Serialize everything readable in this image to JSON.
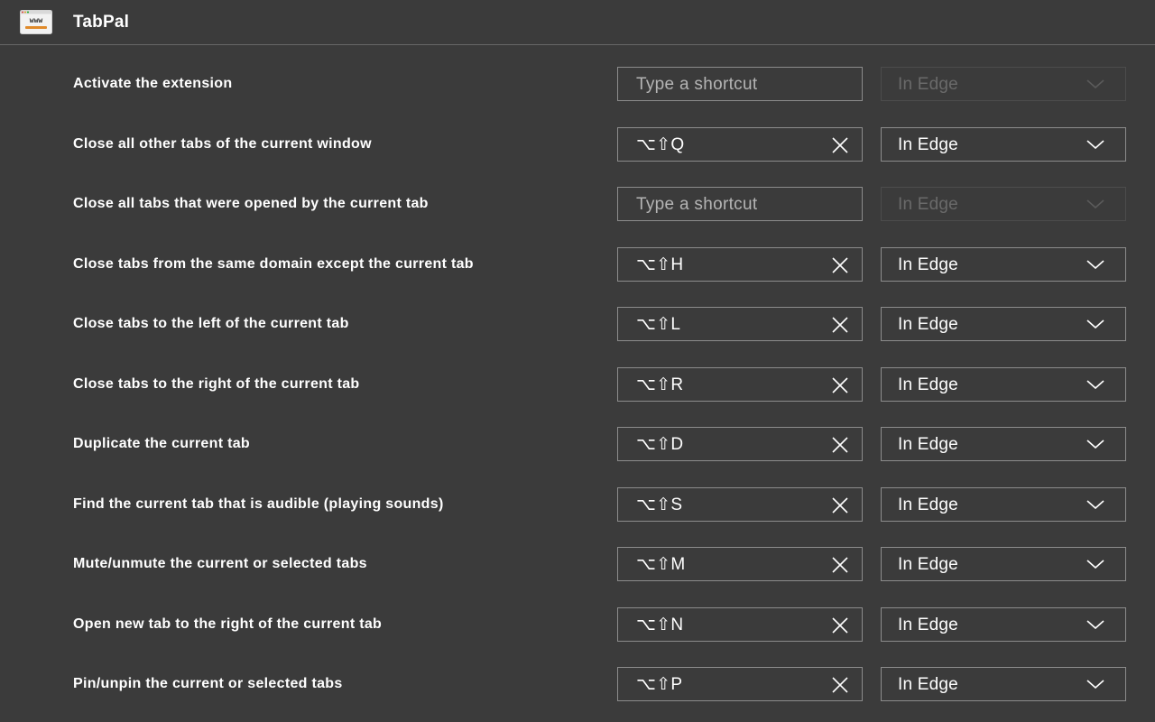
{
  "header": {
    "title": "TabPal",
    "icon_text": "www"
  },
  "rows": [
    {
      "label": "Activate the extension",
      "shortcut": "",
      "placeholder": "Type a shortcut",
      "scope": "In Edge",
      "disabled": true
    },
    {
      "label": "Close all other tabs of the current window",
      "shortcut": "⌥⇧Q",
      "placeholder": "Type a shortcut",
      "scope": "In Edge",
      "disabled": false
    },
    {
      "label": "Close all tabs that were opened by the current tab",
      "shortcut": "",
      "placeholder": "Type a shortcut",
      "scope": "In Edge",
      "disabled": true
    },
    {
      "label": "Close tabs from the same domain except the current tab",
      "shortcut": "⌥⇧H",
      "placeholder": "Type a shortcut",
      "scope": "In Edge",
      "disabled": false
    },
    {
      "label": "Close tabs to the left of the current tab",
      "shortcut": "⌥⇧L",
      "placeholder": "Type a shortcut",
      "scope": "In Edge",
      "disabled": false
    },
    {
      "label": "Close tabs to the right of the current tab",
      "shortcut": "⌥⇧R",
      "placeholder": "Type a shortcut",
      "scope": "In Edge",
      "disabled": false
    },
    {
      "label": "Duplicate the current tab",
      "shortcut": "⌥⇧D",
      "placeholder": "Type a shortcut",
      "scope": "In Edge",
      "disabled": false
    },
    {
      "label": "Find the current tab that is audible (playing sounds)",
      "shortcut": "⌥⇧S",
      "placeholder": "Type a shortcut",
      "scope": "In Edge",
      "disabled": false
    },
    {
      "label": "Mute/unmute the current or selected tabs",
      "shortcut": "⌥⇧M",
      "placeholder": "Type a shortcut",
      "scope": "In Edge",
      "disabled": false
    },
    {
      "label": "Open new tab to the right of the current tab",
      "shortcut": "⌥⇧N",
      "placeholder": "Type a shortcut",
      "scope": "In Edge",
      "disabled": false
    },
    {
      "label": "Pin/unpin the current or selected tabs",
      "shortcut": "⌥⇧P",
      "placeholder": "Type a shortcut",
      "scope": "In Edge",
      "disabled": false
    }
  ],
  "icons": {
    "app": "browser-window-icon",
    "clear": "close-icon",
    "dropdown": "chevron-down-icon"
  },
  "colors": {
    "background": "#3b3b3b",
    "border": "#8c8c8c",
    "disabled_text": "#6a6a6a",
    "placeholder_text": "#b4b4b4"
  }
}
